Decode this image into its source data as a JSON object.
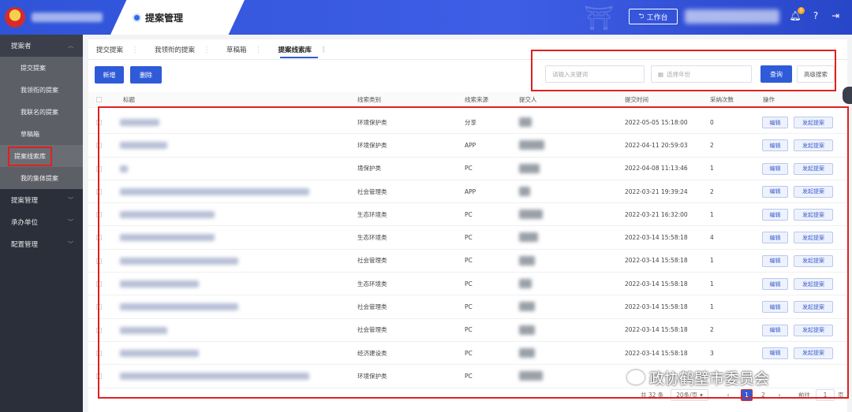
{
  "header": {
    "title": "提案管理",
    "workbench_label": "工作台",
    "notification_count": "0"
  },
  "sidebar": {
    "groups": [
      {
        "label": "提案者",
        "items": [
          "提交提案",
          "我领衔的提案",
          "我联名的提案",
          "草稿箱",
          "提案线索库",
          "我的集体提案"
        ]
      },
      {
        "label": "提案管理"
      },
      {
        "label": "承办单位"
      },
      {
        "label": "配置管理"
      }
    ]
  },
  "tabs": [
    "提交提案",
    "我领衔的提案",
    "草稿箱",
    "提案线索库"
  ],
  "toolbar": {
    "new_label": "新增",
    "delete_label": "删除",
    "keyword_placeholder": "请输入关键词",
    "year_placeholder": "选择年份",
    "search_label": "查询",
    "advanced_label": "高级搜索"
  },
  "table": {
    "headers": {
      "title": "标题",
      "category": "线索类别",
      "source": "线索来源",
      "submitter": "提交人",
      "time": "提交时间",
      "adopt": "采纳次数",
      "ops": "操作"
    },
    "edit_label": "编辑",
    "propose_label": "发起提案",
    "rows": [
      {
        "category": "环境保护类",
        "source": "分享",
        "time": "2022-05-05 15:18:00",
        "adopt": "0"
      },
      {
        "category": "环境保护类",
        "source": "APP",
        "time": "2022-04-11 20:59:03",
        "adopt": "2"
      },
      {
        "category": "境保护类",
        "source": "PC",
        "time": "2022-04-08 11:13:46",
        "adopt": "1"
      },
      {
        "category": "社会管理类",
        "source": "APP",
        "time": "2022-03-21 19:39:24",
        "adopt": "2"
      },
      {
        "category": "生态环境类",
        "source": "PC",
        "time": "2022-03-21 16:32:00",
        "adopt": "1"
      },
      {
        "category": "生态环境类",
        "source": "PC",
        "time": "2022-03-14 15:58:18",
        "adopt": "4"
      },
      {
        "category": "社会管理类",
        "source": "PC",
        "time": "2022-03-14 15:58:18",
        "adopt": "1"
      },
      {
        "category": "生态环境类",
        "source": "PC",
        "time": "2022-03-14 15:58:18",
        "adopt": "1"
      },
      {
        "category": "社会管理类",
        "source": "PC",
        "time": "2022-03-14 15:58:18",
        "adopt": "1"
      },
      {
        "category": "社会管理类",
        "source": "PC",
        "time": "2022-03-14 15:58:18",
        "adopt": "2"
      },
      {
        "category": "经济建设类",
        "source": "PC",
        "time": "2022-03-14 15:58:18",
        "adopt": "3"
      },
      {
        "category": "环境保护类",
        "source": "PC",
        "time": "",
        "adopt": ""
      }
    ]
  },
  "pager": {
    "total": "共 32 条",
    "page_size": "20条/页",
    "pages": [
      "1",
      "2"
    ],
    "goto_label": "前往",
    "goto_value": "1",
    "page_unit": "页"
  },
  "watermark": "政协鹤壁市委员会",
  "colors": {
    "primary": "#2f5bd8",
    "highlight": "#e02020",
    "sidebar": "#2b2f3a"
  }
}
